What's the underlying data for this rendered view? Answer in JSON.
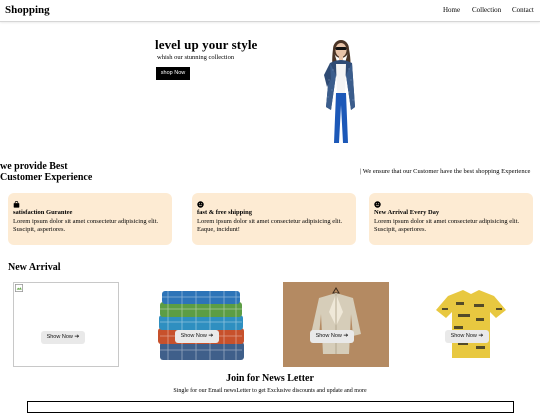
{
  "nav": {
    "brand": "Shopping",
    "links": [
      "Home",
      "Collection",
      "Contact"
    ]
  },
  "hero": {
    "title": "level up your style",
    "subtitle": "whish our stunning collection",
    "button": "shop Now"
  },
  "experience": {
    "title_line1": "we provide Best",
    "title_line2": "Customer Experience",
    "note": "| We ensure that our Customer have the best shopping Experience",
    "cards": [
      {
        "icon": "bag-icon",
        "title": "satisfaction Gurantee",
        "body": "Lorem ipsum dolor sit amet consectetur adipisicing elit. Suscipit, asperiores."
      },
      {
        "icon": "smile-icon",
        "title": "fast & free shipping",
        "body": "Lorem ipsum dolor sit amet consectetur adipisicing elit. Eaque, incidunt!"
      },
      {
        "icon": "smile-icon",
        "title": "New Arrival Every Day",
        "body": "Lorem ipsum dolor sit amet consectetur adipisicing elit. Suscipit, asperiores."
      }
    ]
  },
  "arrivals": {
    "title": "New Arrival",
    "button": "Show Now",
    "arrow": "➔"
  },
  "newsletter": {
    "title": "Join for News Letter",
    "subtitle": "Single for our Email newsLetter to get Exclusive discounts and update and more"
  },
  "colors": {
    "card_bg": "#fdebd3",
    "button_dark": "#000000",
    "button_light": "#e9e9e9"
  }
}
